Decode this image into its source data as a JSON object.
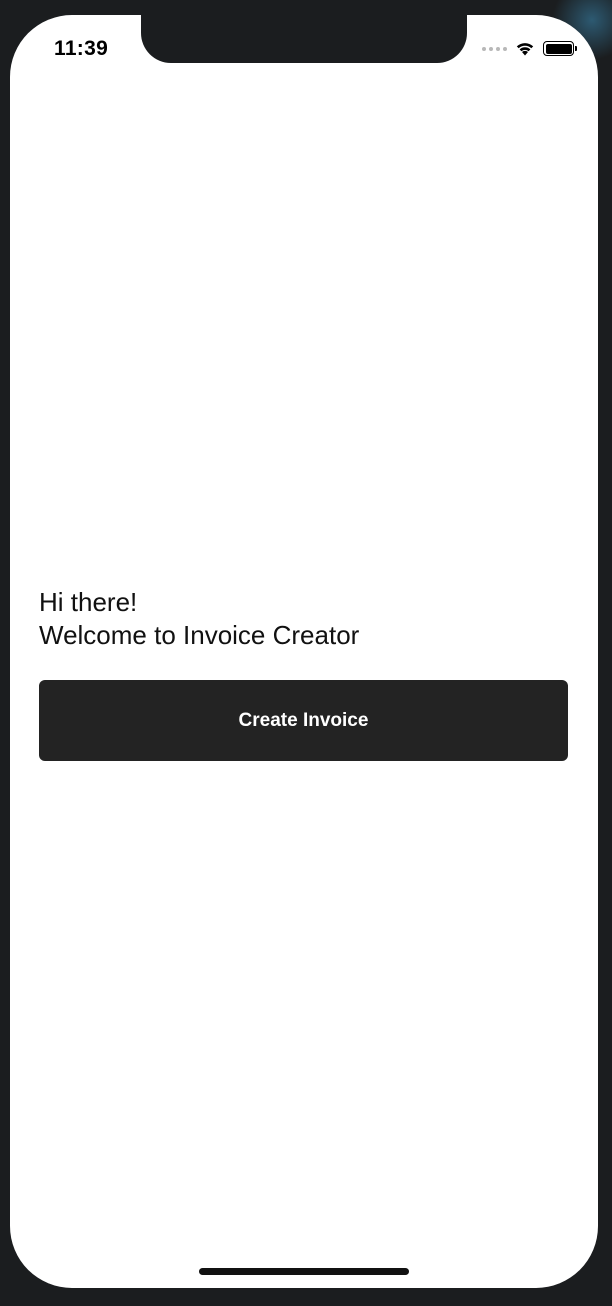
{
  "status_bar": {
    "time": "11:39",
    "icons": [
      "cellular-signal-icon",
      "wifi-icon",
      "battery-icon"
    ]
  },
  "welcome": {
    "line1": "Hi there!",
    "line2": "Welcome to Invoice Creator"
  },
  "actions": {
    "create_invoice_label": "Create Invoice"
  },
  "colors": {
    "button_background": "#232323",
    "button_text": "#ffffff",
    "screen_background": "#ffffff",
    "device_frame": "#1b1d1f"
  }
}
